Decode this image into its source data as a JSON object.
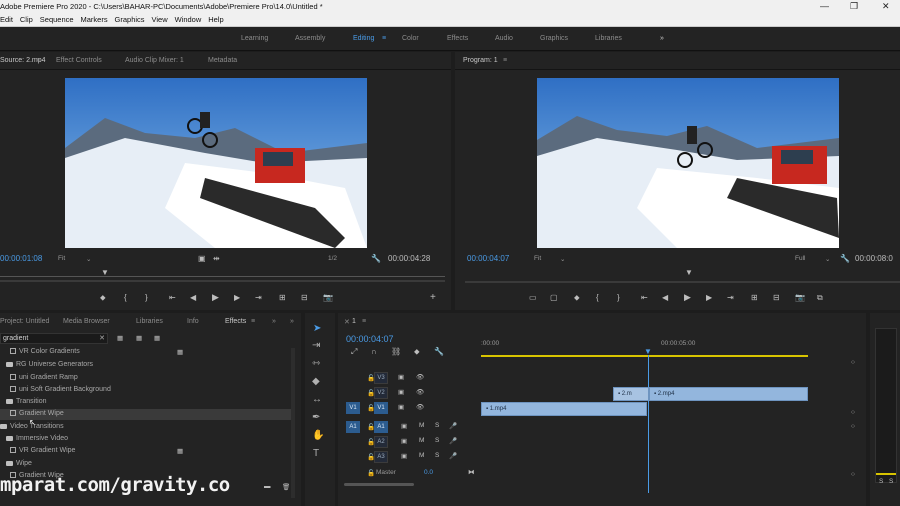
{
  "title_bar": {
    "title": "Adobe Premiere Pro 2020 - C:\\Users\\BAHAR-PC\\Documents\\Adobe\\Premiere Pro\\14.0\\Untitled *"
  },
  "menu": [
    "Edit",
    "Clip",
    "Sequence",
    "Markers",
    "Graphics",
    "View",
    "Window",
    "Help"
  ],
  "workspaces": [
    "Learning",
    "Assembly",
    "Editing",
    "Color",
    "Effects",
    "Audio",
    "Graphics",
    "Libraries"
  ],
  "active_workspace": "Editing",
  "source_panel": {
    "tabs": [
      "Source: 2.mp4",
      "Effect Controls",
      "Audio Clip Mixer: 1",
      "Metadata"
    ],
    "timecode_current": "00:00:01:08",
    "fit": "Fit",
    "resolution": "1/2",
    "timecode_duration": "00:00:04:28"
  },
  "program_panel": {
    "tab": "Program: 1",
    "timecode_current": "00:00:04:07",
    "fit": "Fit",
    "resolution": "Full",
    "timecode_duration": "00:00:08:0"
  },
  "effects_panel": {
    "tabs": [
      "Project: Untitled",
      "Media Browser",
      "Libraries",
      "Info",
      "Effects"
    ],
    "search_value": "gradient",
    "items": [
      {
        "type": "effect",
        "label": "VR Color Gradients",
        "indent": 1
      },
      {
        "type": "folder",
        "label": "RG Universe Generators",
        "indent": 0
      },
      {
        "type": "effect",
        "label": "uni Gradient Ramp",
        "indent": 1
      },
      {
        "type": "effect",
        "label": "uni Soft Gradient Background",
        "indent": 1
      },
      {
        "type": "folder",
        "label": "Transition",
        "indent": 0
      },
      {
        "type": "effect",
        "label": "Gradient Wipe",
        "indent": 1
      },
      {
        "type": "folder",
        "label": "Video Transitions",
        "indent": 0
      },
      {
        "type": "folder",
        "label": "Immersive Video",
        "indent": 0
      },
      {
        "type": "effect",
        "label": "VR Gradient Wipe",
        "indent": 1
      },
      {
        "type": "folder",
        "label": "Wipe",
        "indent": 0
      },
      {
        "type": "effect",
        "label": "Gradient Wipe",
        "indent": 1
      }
    ]
  },
  "timeline": {
    "sequence_tab": "1",
    "timecode": "00:00:04:07",
    "ruler": [
      ":00:00",
      "00:00:05:00"
    ],
    "video_tracks": [
      "V3",
      "V2",
      "V1"
    ],
    "audio_tracks": [
      "A1",
      "A2",
      "A3"
    ],
    "source_patch_v": "V1",
    "source_patch_a": "A1",
    "master_label": "Master",
    "master_value": "0.0",
    "clips": [
      {
        "label": "1.mp4",
        "track": "V1"
      },
      {
        "label": "2.m",
        "track": "V2"
      },
      {
        "label": "2.mp4",
        "track": "V2"
      }
    ]
  },
  "watermark": "mparat.com/gravity.co"
}
